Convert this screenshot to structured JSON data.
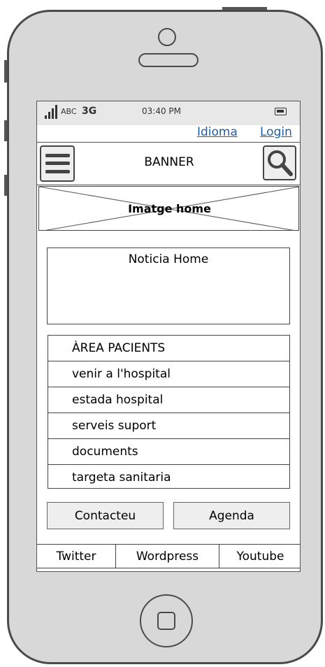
{
  "status_bar": {
    "carrier": "ABC",
    "network": "3G",
    "time": "03:40 PM"
  },
  "top_links": {
    "language": "Idioma",
    "login": "Login"
  },
  "header": {
    "banner": "BANNER",
    "menu_icon": "hamburger-icon",
    "search_icon": "search-icon"
  },
  "hero_image": {
    "label": "Imatge home"
  },
  "news": {
    "title": "Noticia Home"
  },
  "patient_area": {
    "title": "ÀREA PACIENTS",
    "items": [
      "venir a l'hospital",
      "estada hospital",
      "serveis suport",
      "documents",
      "targeta sanitaria"
    ]
  },
  "buttons": {
    "contact": "Contacteu",
    "agenda": "Agenda"
  },
  "social_tabs": [
    "Twitter",
    "Wordpress",
    "Youtube"
  ]
}
